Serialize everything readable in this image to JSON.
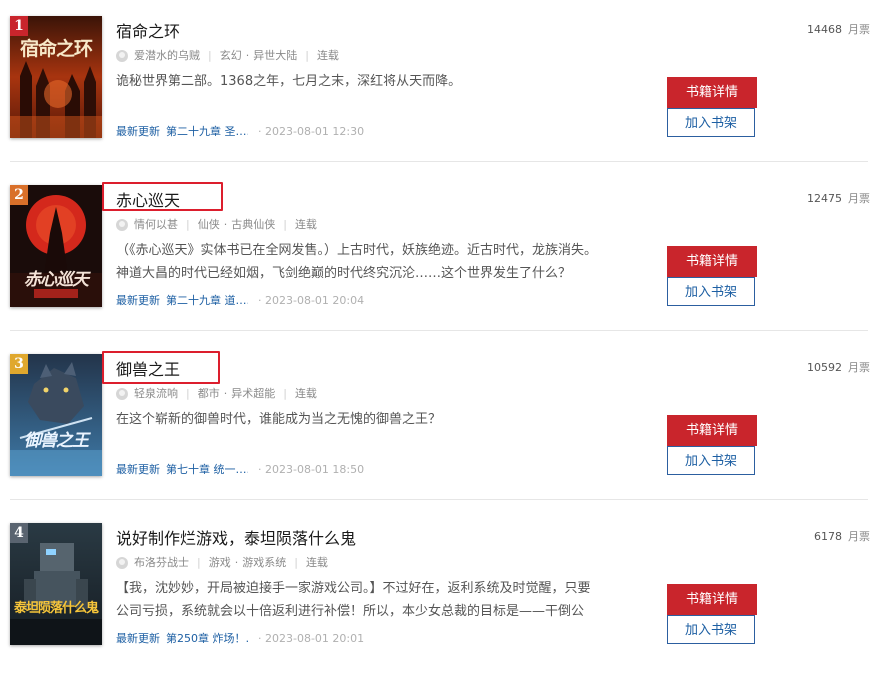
{
  "books": [
    {
      "rank": "1",
      "rank_color": "#c9252c",
      "cover_title": "宿命之环",
      "title": "宿命之环",
      "highlighted": false,
      "author": "爱潜水的乌贼",
      "genre": "玄幻",
      "subgenre": "异世大陆",
      "status": "连载",
      "intro": "诡秘世界第二部。1368之年，七月之末，深红将从天而降。",
      "update_label": "最新更新",
      "latest_chapter": "第二十九章 圣……",
      "update_time": "· 2023-08-01 12:30",
      "votes": "14468",
      "votes_unit": "月票",
      "detail_label": "书籍详情",
      "shelf_label": "加入书架"
    },
    {
      "rank": "2",
      "rank_color": "#d9702a",
      "cover_title": "赤心巡天",
      "title": "赤心巡天",
      "highlighted": true,
      "author": "情何以甚",
      "genre": "仙侠",
      "subgenre": "古典仙侠",
      "status": "连载",
      "intro": "（《赤心巡天》实体书已在全网发售。）上古时代，妖族绝迹。近古时代，龙族消失。神道大昌的时代已经如烟，飞剑绝巅的时代终究沉沦……这个世界发生了什么？",
      "update_label": "最新更新",
      "latest_chapter": "第二十九章 道……",
      "update_time": "· 2023-08-01 20:04",
      "votes": "12475",
      "votes_unit": "月票",
      "detail_label": "书籍详情",
      "shelf_label": "加入书架"
    },
    {
      "rank": "3",
      "rank_color": "#e0a82e",
      "cover_title": "御兽之王",
      "title": "御兽之王",
      "highlighted": true,
      "author": "轻泉流响",
      "genre": "都市",
      "subgenre": "异术超能",
      "status": "连载",
      "intro": "在这个崭新的御兽时代，谁能成为当之无愧的御兽之王？",
      "update_label": "最新更新",
      "latest_chapter": "第七十章 统一……",
      "update_time": "· 2023-08-01 18:50",
      "votes": "10592",
      "votes_unit": "月票",
      "detail_label": "书籍详情",
      "shelf_label": "加入书架"
    },
    {
      "rank": "4",
      "rank_color": "#5a6470",
      "cover_title": "泰坦陨落什么鬼",
      "title": "说好制作烂游戏，泰坦陨落什么鬼",
      "highlighted": false,
      "author": "布洛芬战士",
      "genre": "游戏",
      "subgenre": "游戏系统",
      "status": "连载",
      "intro": "【我，沈妙妙，开局被迫接手一家游戏公司。】不过好在，返利系统及时觉醒，只要公司亏损，系统就会以十倍返利进行补偿！所以，本少女总裁的目标是——干倒公",
      "update_label": "最新更新",
      "latest_chapter": "第250章 炸场！……",
      "update_time": "· 2023-08-01 20:01",
      "votes": "6178",
      "votes_unit": "月票",
      "detail_label": "书籍详情",
      "shelf_label": "加入书架"
    }
  ]
}
